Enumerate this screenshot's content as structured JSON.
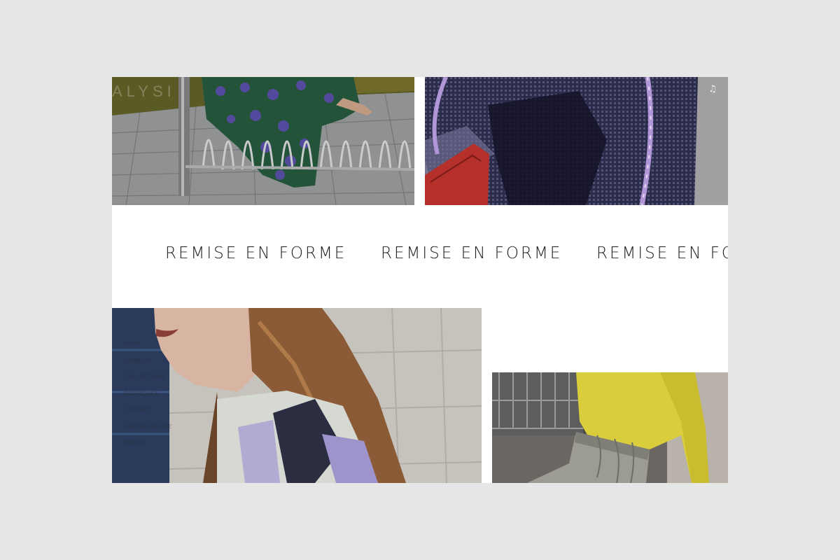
{
  "header": {
    "logo_text": "ALYSI",
    "music_icon": "music-note-icon"
  },
  "marquee": {
    "items": [
      "REMISE EN FORME",
      "REMISE EN FORME",
      "REMISE EN FORME"
    ]
  },
  "side_nav": {
    "items": [
      {
        "label": "SHOP"
      },
      {
        "label": "CHARLES"
      },
      {
        "label": "COLLECTIONS"
      },
      {
        "label": "BOUTIQUES"
      },
      {
        "label": "CONTACT"
      },
      {
        "label": "GARDEN HOUSE"
      },
      {
        "label": "PRESS"
      }
    ]
  },
  "colors": {
    "background": "#e6e6e6",
    "page": "#ffffff",
    "text": "#1e1e1e"
  }
}
